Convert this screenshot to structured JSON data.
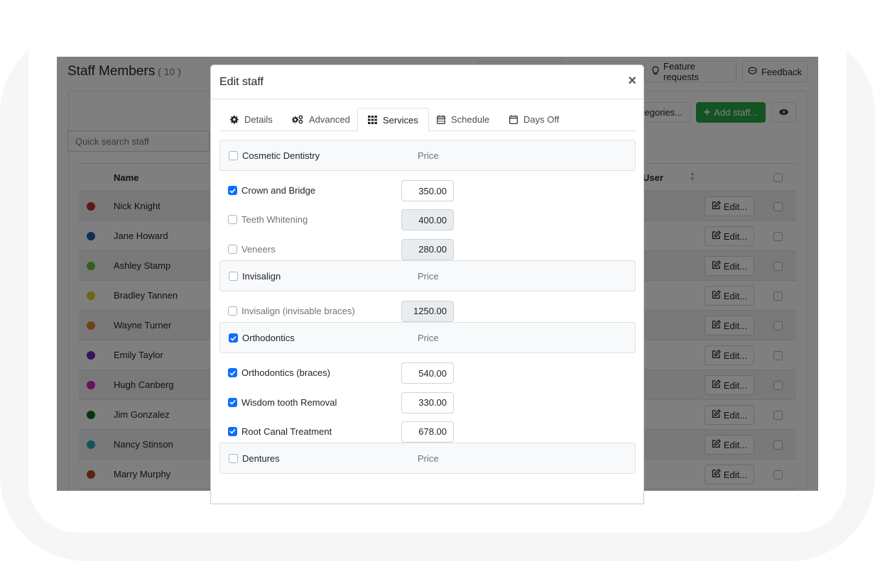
{
  "page": {
    "title": "Staff Members",
    "count": "( 10 )",
    "top_buttons": [
      {
        "label": "",
        "icon": "button-icon"
      },
      {
        "label": "",
        "icon": "button-icon"
      },
      {
        "label": "Feature requests",
        "icon": "lightbulb-icon"
      },
      {
        "label": "Feedback",
        "icon": "comment-icon"
      }
    ],
    "categories_button": "tegories...",
    "add_staff_button": "Add staff...",
    "search_placeholder": "Quick search staff",
    "table": {
      "columns": [
        "Name",
        "User"
      ],
      "edit_label": "Edit...",
      "rows": [
        {
          "name": "Nick Knight",
          "color": "#c0302a"
        },
        {
          "name": "Jane Howard",
          "color": "#1d5fa8"
        },
        {
          "name": "Ashley Stamp",
          "color": "#6cbf3f"
        },
        {
          "name": "Bradley Tannen",
          "color": "#d4d22b"
        },
        {
          "name": "Wayne Turner",
          "color": "#d88a2e"
        },
        {
          "name": "Emily Taylor",
          "color": "#6b2bc4"
        },
        {
          "name": "Hugh Canberg",
          "color": "#c928b1"
        },
        {
          "name": "Jim Gonzalez",
          "color": "#0e6a1f"
        },
        {
          "name": "Nancy Stinson",
          "color": "#23adb8"
        },
        {
          "name": "Marry Murphy",
          "color": "#b44b23"
        }
      ]
    }
  },
  "modal": {
    "title": "Edit staff",
    "close_label": "×",
    "tabs": [
      {
        "label": "Details",
        "icon": "gear-icon",
        "active": false
      },
      {
        "label": "Advanced",
        "icon": "gears-icon",
        "active": false
      },
      {
        "label": "Services",
        "icon": "grid-icon",
        "active": true
      },
      {
        "label": "Schedule",
        "icon": "calendar-icon",
        "active": false
      },
      {
        "label": "Days Off",
        "icon": "calendar-empty-icon",
        "active": false
      }
    ],
    "price_header": "Price",
    "categories": [
      {
        "name": "Cosmetic Dentistry",
        "checked": false,
        "services": [
          {
            "name": "Crown and Bridge",
            "checked": true,
            "price": "350.00"
          },
          {
            "name": "Teeth Whitening",
            "checked": false,
            "price": "400.00"
          },
          {
            "name": "Veneers",
            "checked": false,
            "price": "280.00"
          }
        ]
      },
      {
        "name": "Invisalign",
        "checked": false,
        "services": [
          {
            "name": "Invisalign (invisable braces)",
            "checked": false,
            "price": "1250.00"
          }
        ]
      },
      {
        "name": "Orthodontics",
        "checked": true,
        "services": [
          {
            "name": "Orthodontics (braces)",
            "checked": true,
            "price": "540.00"
          },
          {
            "name": "Wisdom tooth Removal",
            "checked": true,
            "price": "330.00"
          },
          {
            "name": "Root Canal Treatment",
            "checked": true,
            "price": "678.00"
          }
        ]
      },
      {
        "name": "Dentures",
        "checked": false,
        "services": []
      }
    ]
  }
}
